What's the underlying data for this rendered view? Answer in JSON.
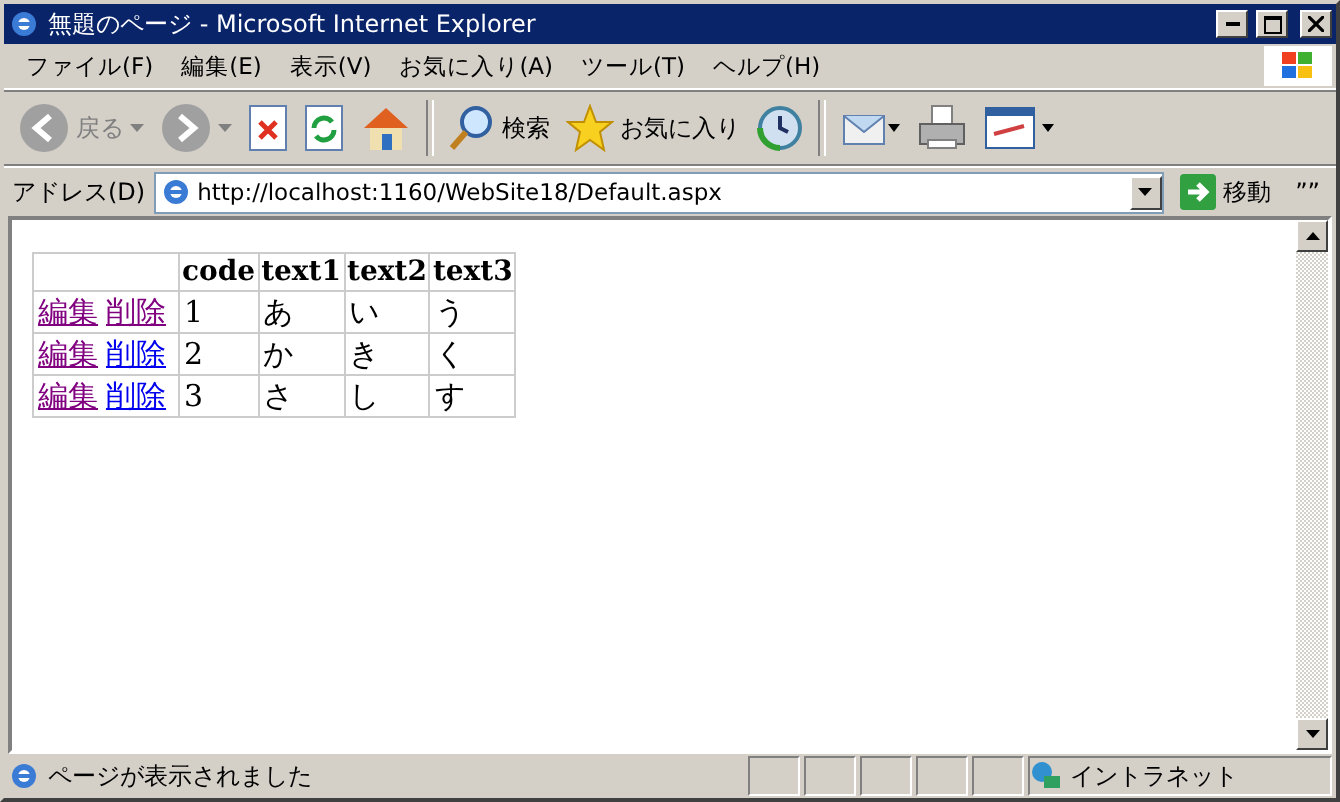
{
  "window": {
    "title": "無題のページ - Microsoft Internet Explorer"
  },
  "menu": [
    "ファイル(F)",
    "編集(E)",
    "表示(V)",
    "お気に入り(A)",
    "ツール(T)",
    "ヘルプ(H)"
  ],
  "toolbar": [
    {
      "kind": "back",
      "label": "戻る",
      "disabled": true
    },
    {
      "kind": "forward",
      "disabled": true
    },
    {
      "kind": "stop"
    },
    {
      "kind": "refresh"
    },
    {
      "kind": "home"
    },
    {
      "kind": "sep"
    },
    {
      "kind": "search",
      "label": "検索"
    },
    {
      "kind": "favorites",
      "label": "お気に入り"
    },
    {
      "kind": "history"
    },
    {
      "kind": "sep"
    },
    {
      "kind": "mail"
    },
    {
      "kind": "print"
    },
    {
      "kind": "edit"
    }
  ],
  "address": {
    "label": "アドレス(D)",
    "value": "http://localhost:1160/WebSite18/Default.aspx",
    "go": "移動",
    "links": "””"
  },
  "table": {
    "columns": [
      "",
      "code",
      "text1",
      "text2",
      "text3"
    ],
    "rows": [
      {
        "cells": [
          {
            "links": [
              {
                "label": "編集",
                "visited": true
              },
              {
                "label": "削除",
                "visited": true
              }
            ]
          },
          "1",
          "あ",
          "い",
          "う"
        ]
      },
      {
        "cells": [
          {
            "links": [
              {
                "label": "編集",
                "visited": true
              },
              {
                "label": "削除",
                "visited": false
              }
            ]
          },
          "2",
          "か",
          "き",
          "く"
        ]
      },
      {
        "cells": [
          {
            "links": [
              {
                "label": "編集",
                "visited": true
              },
              {
                "label": "削除",
                "visited": false
              }
            ]
          },
          "3",
          "さ",
          "し",
          "す"
        ]
      }
    ]
  },
  "status_bar": {
    "text": "ページが表示されました",
    "zone": "イントラネット"
  }
}
